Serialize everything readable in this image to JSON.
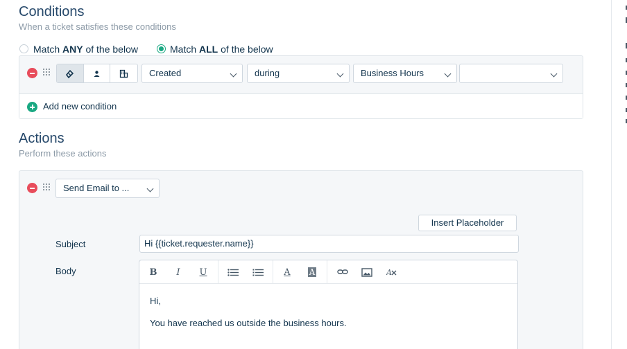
{
  "conditions": {
    "title": "Conditions",
    "subtitle": "When a ticket satisfies these conditions",
    "match_any": {
      "prefix": "Match ",
      "bold": "ANY",
      "suffix": " of the below",
      "selected": false
    },
    "match_all": {
      "prefix": "Match ",
      "bold": "ALL",
      "suffix": " of the below",
      "selected": true
    },
    "row": {
      "segments": [
        {
          "icon": "ticket-icon",
          "active": true
        },
        {
          "icon": "user-icon",
          "active": false
        },
        {
          "icon": "company-icon",
          "active": false
        }
      ],
      "field_value": "Created",
      "operator_value": "during",
      "value_value": "Business Hours",
      "extra_value": ""
    },
    "add_label": "Add new condition"
  },
  "actions": {
    "title": "Actions",
    "subtitle": "Perform these actions",
    "action_value": "Send Email to ...",
    "insert_placeholder_label": "Insert Placeholder",
    "subject_label": "Subject",
    "subject_value": "Hi {{ticket.requester.name}}",
    "body_label": "Body",
    "toolbar": {
      "bold": "B",
      "italic": "I",
      "underline": "U",
      "font_color": "A",
      "bg_color": "A"
    },
    "body_lines": [
      "Hi,",
      "You have reached us outside the business hours."
    ]
  },
  "colors": {
    "accent_green": "#19a882",
    "danger_red": "#e84c5b",
    "text_dark": "#12344d",
    "text_muted": "#8c9aa7"
  }
}
